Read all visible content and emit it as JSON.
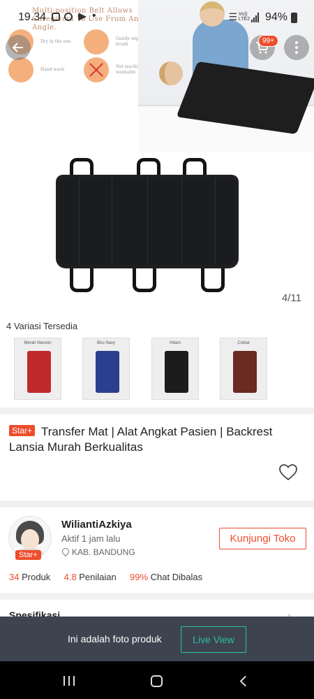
{
  "status_bar": {
    "time": "19.34",
    "network": "LTE2",
    "volte": "Vo))",
    "battery": "94%"
  },
  "product_image": {
    "promo_text": "Multi-position Belt Allows Caregivers To Use From Any Angle.",
    "features": [
      {
        "text": "Dry in the sun",
        "icon": "sun-icon"
      },
      {
        "text": "Gently wipe with a brush",
        "icon": "brush-icon"
      },
      {
        "text": "Hand wash",
        "icon": "hand-wash-icon"
      },
      {
        "text": "Not machine washable",
        "icon": "no-machine-wash-icon"
      }
    ],
    "counter": "4/11"
  },
  "header": {
    "cart_badge": "99+",
    "back_icon": "back-arrow-icon",
    "cart_icon": "cart-icon",
    "more_icon": "more-vertical-icon"
  },
  "variations": {
    "title": "4 Variasi Tersedia",
    "items": [
      {
        "label": "Merah Maroon",
        "color": "#c0292b"
      },
      {
        "label": "Biru Navy",
        "color": "#2b3f8f"
      },
      {
        "label": "Hitam",
        "color": "#1c1c1e"
      },
      {
        "label": "Coklat",
        "color": "#6b2a22"
      }
    ]
  },
  "product": {
    "badge": "Star+",
    "title": "Transfer Mat | Alat Angkat Pasien | Backrest Lansia Murah Berkualitas"
  },
  "shop": {
    "name": "WiliantiAzkiya",
    "badge": "Star+",
    "active": "Aktif 1 jam lalu",
    "location": "KAB. BANDUNG",
    "visit_label": "Kunjungi Toko",
    "stats": [
      {
        "value": "34",
        "label": "Produk"
      },
      {
        "value": "4.8",
        "label": "Penilaian"
      },
      {
        "value": "99%",
        "label": "Chat Dibalas"
      }
    ]
  },
  "spec_label": "Spesifikasi",
  "banner": {
    "text": "Ini adalah foto produk",
    "button": "Live View"
  },
  "colors": {
    "accent": "#ee4d2d",
    "teal": "#2bbfa8",
    "banner_bg": "#3d4450"
  }
}
